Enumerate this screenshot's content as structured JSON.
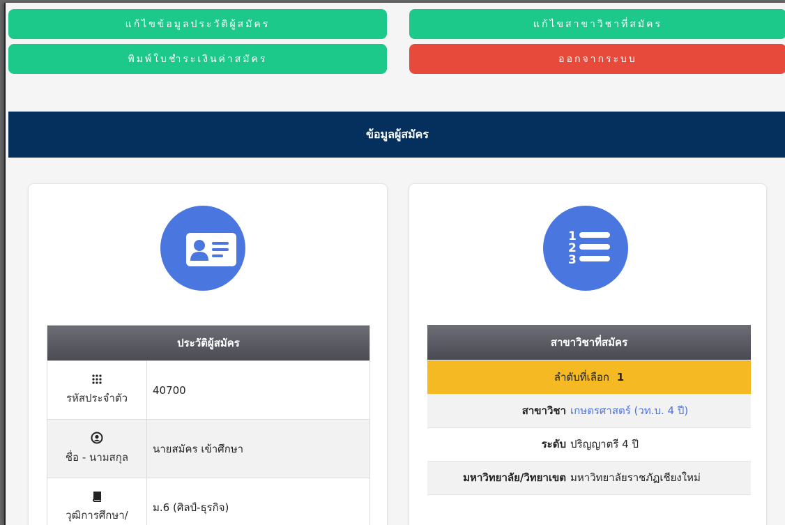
{
  "actions": {
    "edit_profile": "แก้ไขข้อมูลประวัติผู้สมัคร",
    "edit_major": "แก้ไขสาขาวิชาที่สมัคร",
    "print_payment": "พิมพ์ใบชำระเงินค่าสมัคร",
    "logout": "ออกจากระบบ"
  },
  "banner": {
    "title": "ข้อมูลผู้สมัคร"
  },
  "profile": {
    "header": "ประวัติผู้สมัคร",
    "icon": "id-card-icon",
    "rows": [
      {
        "icon": "dialpad-icon",
        "label": "รหัสประจำตัว",
        "value": "40700"
      },
      {
        "icon": "user-circle-icon",
        "label": "ชื่อ - นามสกุล",
        "value": "นายสมัคร เข้าศึกษา"
      },
      {
        "icon": "book-icon",
        "label": "วุฒิการศึกษา/",
        "value": "ม.6 (ศิลป์-ธุรกิจ)"
      }
    ]
  },
  "application": {
    "header": "สาขาวิชาที่สมัคร",
    "icon": "numbered-list-icon",
    "order_label": "ลำดับที่เลือก",
    "order_value": "1",
    "rows": [
      {
        "label": "สาขาวิชา",
        "value": "เกษตรศาสตร์ (วท.บ. 4 ปี)",
        "link": true
      },
      {
        "label": "ระดับ",
        "value": "ปริญญาตรี 4 ปี"
      },
      {
        "label": "มหาวิทยาลัย/วิทยาเขต",
        "value": "มหาวิทยาลัยราชภัฏเชียงใหม่"
      }
    ]
  },
  "colors": {
    "green": "#1cc88a",
    "red": "#e74a3b",
    "navy": "#05305e",
    "icon_blue": "#4a76e0",
    "gold": "#f4b923",
    "link": "#4e73df"
  }
}
